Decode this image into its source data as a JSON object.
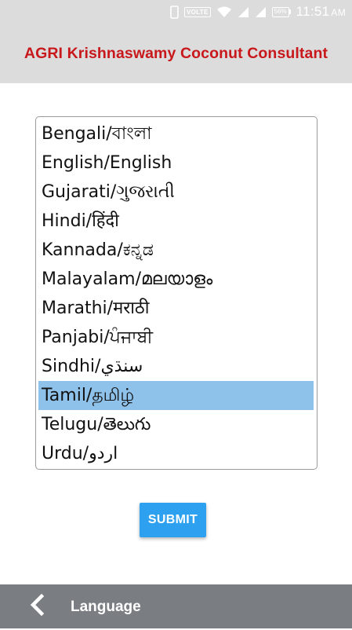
{
  "status_bar": {
    "network_label": "VOLTE",
    "battery_percent": "56%",
    "time": "11:51",
    "ampm": "AM"
  },
  "app_bar": {
    "title": "AGRI Krishnaswamy Coconut Consultant"
  },
  "languages": {
    "options": [
      "Bengali/বাংলা",
      "English/English",
      "Gujarati/ગુજરાતી",
      "Hindi/हिंदी",
      "Kannada/ಕನ್ನಡ",
      "Malayalam/മലയാളം",
      "Marathi/मराठी",
      "Panjabi/ਪੰਜਾਬੀ",
      "Sindhi/سنڌي",
      "Tamil/தமிழ்",
      "Telugu/తెలుగు",
      "Urdu/اردو"
    ],
    "selected": "Tamil/தமிழ்"
  },
  "actions": {
    "submit_label": "SUBMIT"
  },
  "bottom_bar": {
    "label": "Language"
  },
  "colors": {
    "title": "#c8181c",
    "header_bg": "#dcdcdc",
    "selected_bg": "#8fc2ea",
    "button_bg": "#2ea0f0",
    "bottom_bar_bg": "#7a7e83"
  },
  "icons": {
    "back": "chevron-left-icon",
    "phone": "phone-icon",
    "wifi": "wifi-icon",
    "signal": "signal-icon"
  }
}
